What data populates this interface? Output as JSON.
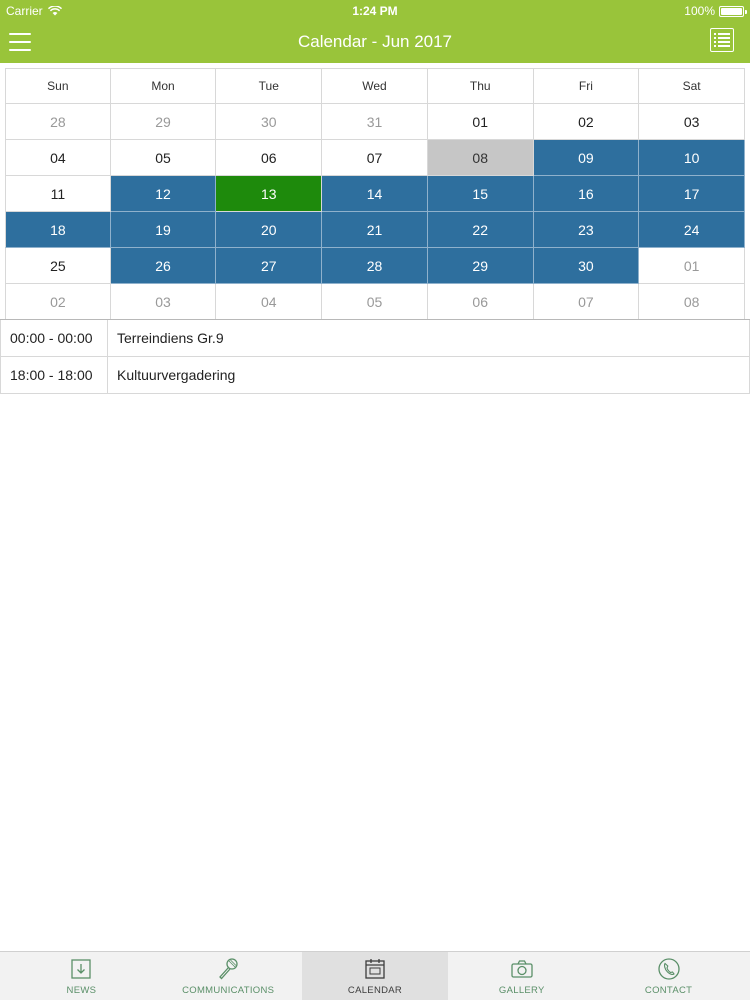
{
  "status_bar": {
    "carrier": "Carrier",
    "time": "1:24 PM",
    "battery": "100%"
  },
  "nav": {
    "title": "Calendar - Jun 2017"
  },
  "calendar": {
    "weekdays": [
      "Sun",
      "Mon",
      "Tue",
      "Wed",
      "Thu",
      "Fri",
      "Sat"
    ],
    "weeks": [
      [
        {
          "d": "28",
          "state": "other"
        },
        {
          "d": "29",
          "state": "other"
        },
        {
          "d": "30",
          "state": "other"
        },
        {
          "d": "31",
          "state": "other"
        },
        {
          "d": "01",
          "state": "normal"
        },
        {
          "d": "02",
          "state": "normal"
        },
        {
          "d": "03",
          "state": "normal"
        }
      ],
      [
        {
          "d": "04",
          "state": "normal"
        },
        {
          "d": "05",
          "state": "normal"
        },
        {
          "d": "06",
          "state": "normal"
        },
        {
          "d": "07",
          "state": "normal"
        },
        {
          "d": "08",
          "state": "selected"
        },
        {
          "d": "09",
          "state": "event"
        },
        {
          "d": "10",
          "state": "event"
        }
      ],
      [
        {
          "d": "11",
          "state": "normal"
        },
        {
          "d": "12",
          "state": "event"
        },
        {
          "d": "13",
          "state": "today"
        },
        {
          "d": "14",
          "state": "event"
        },
        {
          "d": "15",
          "state": "event"
        },
        {
          "d": "16",
          "state": "event"
        },
        {
          "d": "17",
          "state": "event"
        }
      ],
      [
        {
          "d": "18",
          "state": "event"
        },
        {
          "d": "19",
          "state": "event"
        },
        {
          "d": "20",
          "state": "event"
        },
        {
          "d": "21",
          "state": "event"
        },
        {
          "d": "22",
          "state": "event"
        },
        {
          "d": "23",
          "state": "event"
        },
        {
          "d": "24",
          "state": "event"
        }
      ],
      [
        {
          "d": "25",
          "state": "normal"
        },
        {
          "d": "26",
          "state": "event"
        },
        {
          "d": "27",
          "state": "event"
        },
        {
          "d": "28",
          "state": "event"
        },
        {
          "d": "29",
          "state": "event"
        },
        {
          "d": "30",
          "state": "event"
        },
        {
          "d": "01",
          "state": "other"
        }
      ],
      [
        {
          "d": "02",
          "state": "other"
        },
        {
          "d": "03",
          "state": "other"
        },
        {
          "d": "04",
          "state": "other"
        },
        {
          "d": "05",
          "state": "other"
        },
        {
          "d": "06",
          "state": "other"
        },
        {
          "d": "07",
          "state": "other"
        },
        {
          "d": "08",
          "state": "other"
        }
      ]
    ]
  },
  "events": [
    {
      "time": "00:00 - 00:00",
      "name": "Terreindiens Gr.9"
    },
    {
      "time": "18:00 - 18:00",
      "name": "Kultuurvergadering"
    }
  ],
  "tabs": [
    {
      "label": "NEWS",
      "icon": "news-icon",
      "active": false
    },
    {
      "label": "COMMUNICATIONS",
      "icon": "microphone-icon",
      "active": false
    },
    {
      "label": "CALENDAR",
      "icon": "calendar-icon",
      "active": true
    },
    {
      "label": "GALLERY",
      "icon": "camera-icon",
      "active": false
    },
    {
      "label": "CONTACT",
      "icon": "phone-icon",
      "active": false
    }
  ],
  "colors": {
    "header_green": "#99c43a",
    "event_blue": "#2e6f9e",
    "today_green": "#1e8a0c",
    "selected_gray": "#c6c6c6",
    "tab_icon_green": "#5a8f68"
  }
}
